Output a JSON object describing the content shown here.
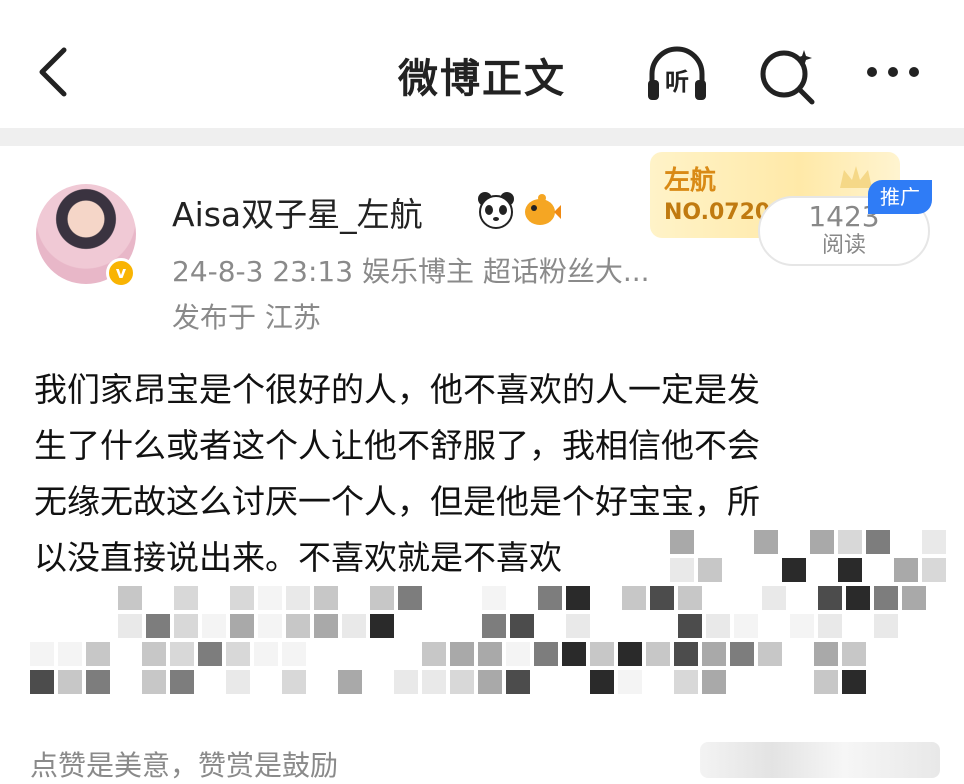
{
  "header": {
    "title": "微博正文",
    "listen_label": "听",
    "icons": [
      "back-icon",
      "listen-icon",
      "search-icon",
      "more-icon"
    ]
  },
  "post": {
    "author": "Aisa双子星_左航",
    "verified_badge": "v",
    "meta": "24-8-3 23:13  娱乐博主 超话粉丝大...",
    "location": "发布于 江苏",
    "fan_card": {
      "name": "左航",
      "number": "NO.0720"
    },
    "ad_label": "推广",
    "read_count": "1423",
    "read_label": "阅读",
    "lines": [
      "我们家昂宝是个很好的人，他不喜欢的人一定是发",
      "生了什么或者这个人让他不舒服了，我相信他不会",
      "无缘无故这么讨厌一个人，但是他是个好宝宝，所",
      "以没直接说出来。不喜欢就是不喜欢"
    ]
  },
  "footer": {
    "text": "点赞是美意，赞赏是鼓励"
  },
  "colors": {
    "accent_blue": "#2f7cf6",
    "vip_gold": "#f9b403",
    "fan_card_text": "#d98a16",
    "secondary_text": "#8a8a8a"
  }
}
